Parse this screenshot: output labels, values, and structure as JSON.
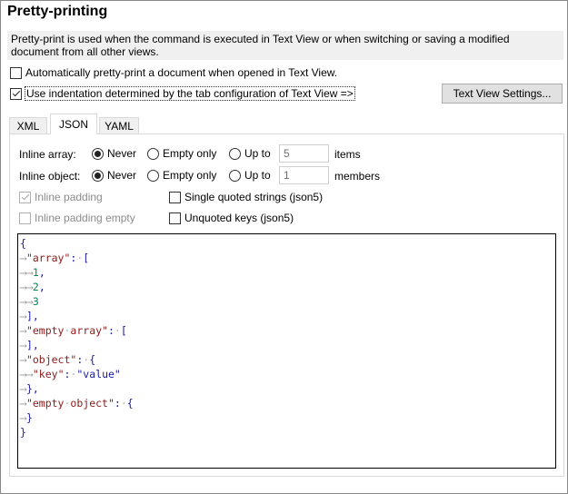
{
  "title": "Pretty-printing",
  "description": "Pretty-print is used when the command is executed in Text View or when switching or saving a modified document from all other views.",
  "options": {
    "auto_pretty_print": {
      "label": "Automatically pretty-print a document when opened in Text View.",
      "checked": false
    },
    "use_indentation": {
      "label": "Use indentation determined by the tab configuration of Text View =>",
      "checked": true
    }
  },
  "text_view_settings_button": "Text View Settings...",
  "tabs": [
    {
      "label": "XML",
      "active": false
    },
    {
      "label": "JSON",
      "active": true
    },
    {
      "label": "YAML",
      "active": false
    }
  ],
  "json": {
    "inline_array": {
      "label": "Inline array:",
      "options": [
        "Never",
        "Empty only",
        "Up to"
      ],
      "selected": "Never",
      "value": "5",
      "unit": "items"
    },
    "inline_object": {
      "label": "Inline object:",
      "options": [
        "Never",
        "Empty only",
        "Up to"
      ],
      "selected": "Never",
      "value": "1",
      "unit": "members"
    },
    "inline_padding": {
      "label": "Inline padding",
      "checked": true,
      "disabled": true
    },
    "inline_padding_empty": {
      "label": "Inline padding empty",
      "checked": false,
      "disabled": true
    },
    "single_quoted": {
      "label": "Single quoted strings (json5)",
      "checked": false
    },
    "unquoted_keys": {
      "label": "Unquoted keys (json5)",
      "checked": false
    }
  },
  "preview_lines": [
    "{",
    "→\"array\":·[",
    "→→1,",
    "→→2,",
    "→→3",
    "→],",
    "→\"empty·array\":·[",
    "→],",
    "→\"object\":·{",
    "→→\"key\":·\"value\"",
    "→},",
    "→\"empty·object\":·{",
    "→}",
    "}"
  ],
  "colors": {
    "arrow": "#9a9a9a",
    "punctuation": "#1a1aa6",
    "key": "#8b1a1a",
    "number": "#098658"
  }
}
